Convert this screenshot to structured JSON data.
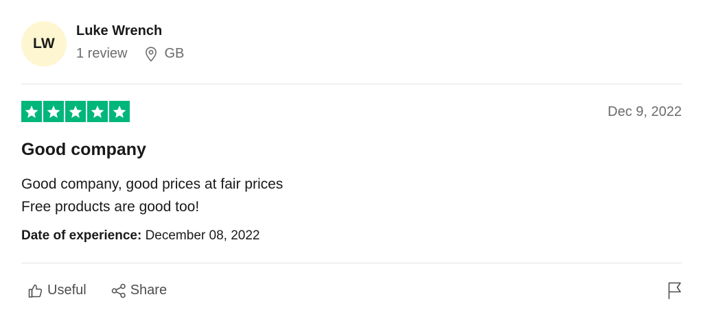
{
  "reviewer": {
    "initials": "LW",
    "name": "Luke Wrench",
    "review_count": "1 review",
    "country": "GB",
    "location_icon": "location-pin-icon",
    "avatar_color": "#fdf6d1"
  },
  "review": {
    "rating": 5,
    "rating_max": 5,
    "star_color": "#00b67a",
    "date": "Dec 9, 2022",
    "title": "Good company",
    "body_lines": [
      "Good company, good prices at fair prices",
      "Free products are good too!"
    ],
    "experience_label": "Date of experience:",
    "experience_date": " December 08, 2022"
  },
  "actions": {
    "useful_label": "Useful",
    "useful_icon": "thumbs-up-icon",
    "share_label": "Share",
    "share_icon": "share-icon",
    "report_icon": "flag-icon"
  }
}
